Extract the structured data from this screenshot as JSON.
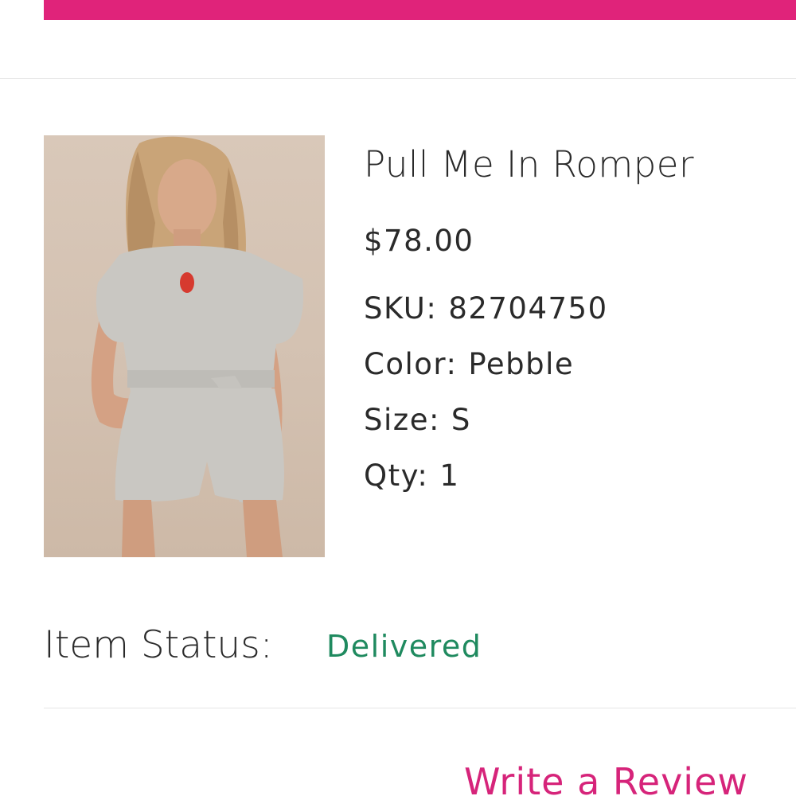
{
  "header": {
    "accent_color": "#e0237a"
  },
  "product": {
    "title": "Pull Me In Romper",
    "price": "$78.00",
    "sku_label": "SKU:",
    "sku": "82704750",
    "color_label": "Color:",
    "color": "Pebble",
    "size_label": "Size:",
    "size": "S",
    "qty_label": "Qty:",
    "qty": "1"
  },
  "status": {
    "label": "Item Status:",
    "value": "Delivered",
    "value_color": "#1f8a5f"
  },
  "actions": {
    "review_label": "Write a Review",
    "review_color": "#d6247a"
  }
}
